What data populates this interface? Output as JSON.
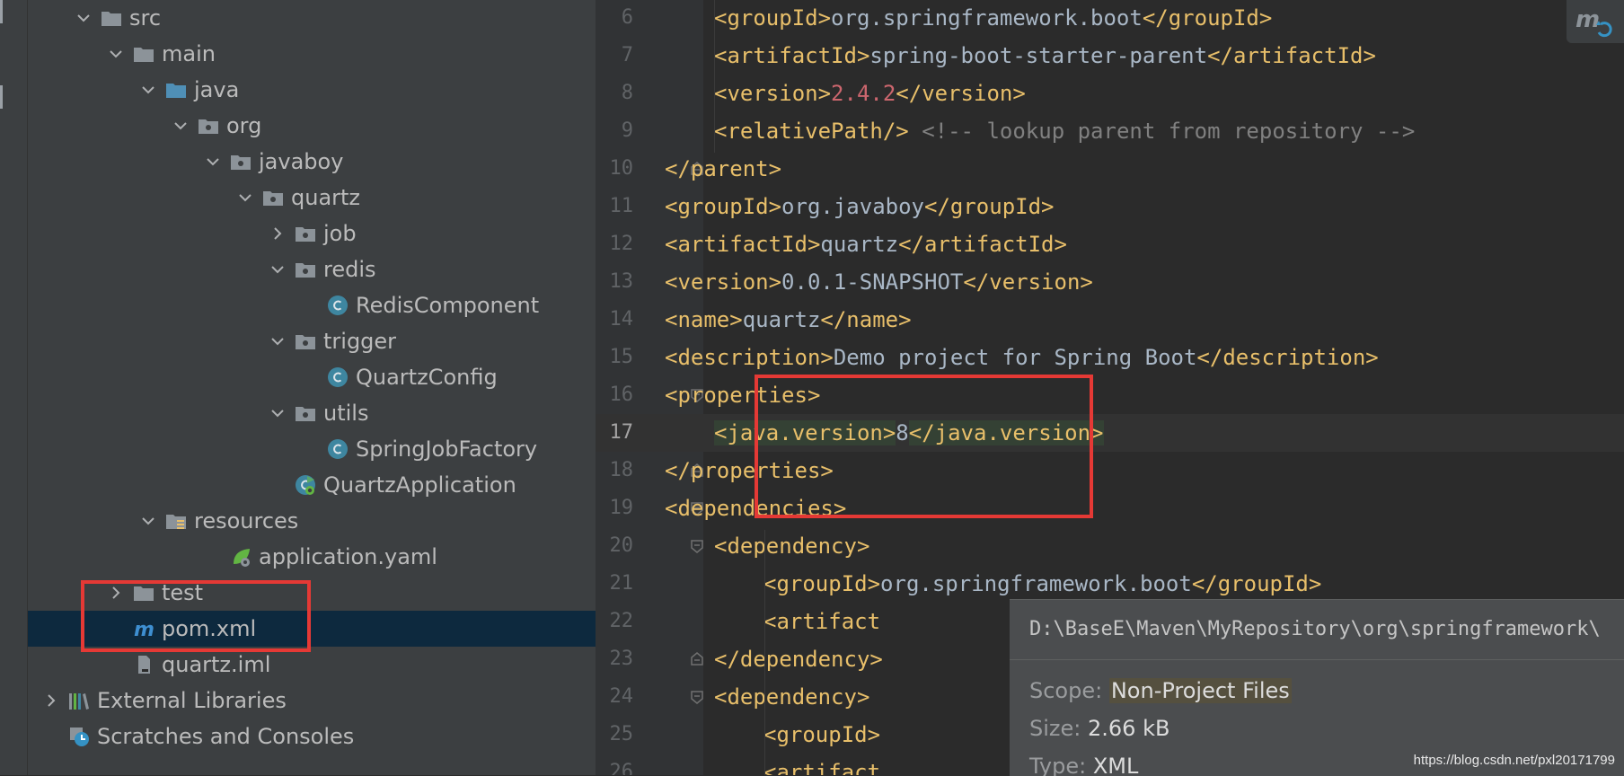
{
  "project_tree": {
    "items": [
      {
        "label": "src",
        "icon": "folder-icon"
      },
      {
        "label": "main",
        "icon": "folder-icon"
      },
      {
        "label": "java",
        "icon": "source-folder-icon"
      },
      {
        "label": "org",
        "icon": "package-icon"
      },
      {
        "label": "javaboy",
        "icon": "package-icon"
      },
      {
        "label": "quartz",
        "icon": "package-icon"
      },
      {
        "label": "job",
        "icon": "package-icon"
      },
      {
        "label": "redis",
        "icon": "package-icon"
      },
      {
        "label": "RedisComponent",
        "icon": "java-class-icon"
      },
      {
        "label": "trigger",
        "icon": "package-icon"
      },
      {
        "label": "QuartzConfig",
        "icon": "java-class-icon"
      },
      {
        "label": "utils",
        "icon": "package-icon"
      },
      {
        "label": "SpringJobFactory",
        "icon": "java-class-icon"
      },
      {
        "label": "QuartzApplication",
        "icon": "spring-boot-app-icon"
      },
      {
        "label": "resources",
        "icon": "resources-folder-icon"
      },
      {
        "label": "application.yaml",
        "icon": "spring-config-icon"
      },
      {
        "label": "test",
        "icon": "folder-icon"
      },
      {
        "label": "pom.xml",
        "icon": "maven-icon",
        "selected": true
      },
      {
        "label": "quartz.iml",
        "icon": "module-file-icon"
      },
      {
        "label": "External Libraries",
        "icon": "libraries-icon"
      },
      {
        "label": "Scratches and Consoles",
        "icon": "scratches-icon"
      }
    ]
  },
  "editor": {
    "lines": [
      {
        "n": "6",
        "code": "<groupId>org.springframework.boot</groupId>"
      },
      {
        "n": "7",
        "code": "<artifactId>spring-boot-starter-parent</artifactId>"
      },
      {
        "n": "8",
        "code": "<version>2.4.2</version>"
      },
      {
        "n": "9",
        "code": "<relativePath/> <!-- lookup parent from repository -->"
      },
      {
        "n": "10",
        "code": "</parent>"
      },
      {
        "n": "11",
        "code": "<groupId>org.javaboy</groupId>"
      },
      {
        "n": "12",
        "code": "<artifactId>quartz</artifactId>"
      },
      {
        "n": "13",
        "code": "<version>0.0.1-SNAPSHOT</version>"
      },
      {
        "n": "14",
        "code": "<name>quartz</name>"
      },
      {
        "n": "15",
        "code": "<description>Demo project for Spring Boot</description>"
      },
      {
        "n": "16",
        "code": "<properties>"
      },
      {
        "n": "17",
        "code": "<java.version>8</java.version>",
        "current": true
      },
      {
        "n": "18",
        "code": "</properties>"
      },
      {
        "n": "19",
        "code": "<dependencies>"
      },
      {
        "n": "20",
        "code": "<dependency>"
      },
      {
        "n": "21",
        "code": "<groupId>org.springframework.boot</groupId>"
      },
      {
        "n": "22",
        "code": "<artifact"
      },
      {
        "n": "23",
        "code": "</dependency>"
      },
      {
        "n": "24",
        "code": "<dependency>"
      },
      {
        "n": "25",
        "code": "<groupId>"
      },
      {
        "n": "26",
        "code": "<artifact"
      }
    ]
  },
  "tooltip": {
    "path": "D:\\BaseE\\Maven\\MyRepository\\org\\springframework\\",
    "scope_label": "Scope:",
    "scope_value": "Non-Project Files",
    "size_label": "Size:",
    "size_value": "2.66 kB",
    "type_label": "Type:",
    "type_value": "XML"
  },
  "maven_button": {
    "icon": "maven-reload-icon"
  },
  "watermark": "https://blog.csdn.net/pxl20171799",
  "colors": {
    "tag": "#e8bf6a",
    "text": "#a9b7c6",
    "number": "#cc666e",
    "comment": "#808080",
    "selection": "#0d293e",
    "highlight_box": "#e53935"
  }
}
